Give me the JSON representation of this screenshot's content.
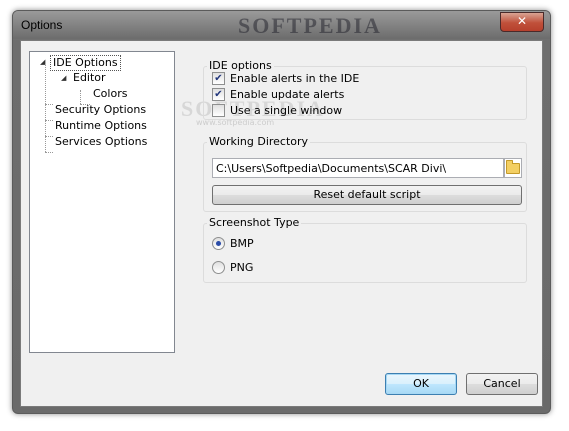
{
  "window": {
    "title": "Options",
    "close_glyph": "✕"
  },
  "watermark": {
    "title": "SOFTPEDIA",
    "url": "www.softpedia.com"
  },
  "tree": {
    "items": [
      {
        "label": "IDE Options",
        "expander": "◢",
        "selected": true
      },
      {
        "label": "Editor",
        "expander": "◢"
      },
      {
        "label": "Colors"
      },
      {
        "label": "Security Options"
      },
      {
        "label": "Runtime Options"
      },
      {
        "label": "Services Options"
      }
    ]
  },
  "ide_options": {
    "title": "IDE options",
    "checkboxes": [
      {
        "label": "Enable alerts in the IDE",
        "checked": true,
        "mark": "✔"
      },
      {
        "label": "Enable update alerts",
        "checked": true,
        "mark": "✔"
      },
      {
        "label": "Use a single window",
        "checked": false,
        "mark": ""
      }
    ]
  },
  "working_directory": {
    "title": "Working Directory",
    "path": "C:\\Users\\Softpedia\\Documents\\SCAR Divi\\",
    "browse_icon": "folder-icon",
    "reset_label": "Reset default script"
  },
  "screenshot_type": {
    "title": "Screenshot Type",
    "options": [
      {
        "label": "BMP",
        "selected": true
      },
      {
        "label": "PNG",
        "selected": false
      }
    ]
  },
  "buttons": {
    "ok": "OK",
    "cancel": "Cancel"
  }
}
